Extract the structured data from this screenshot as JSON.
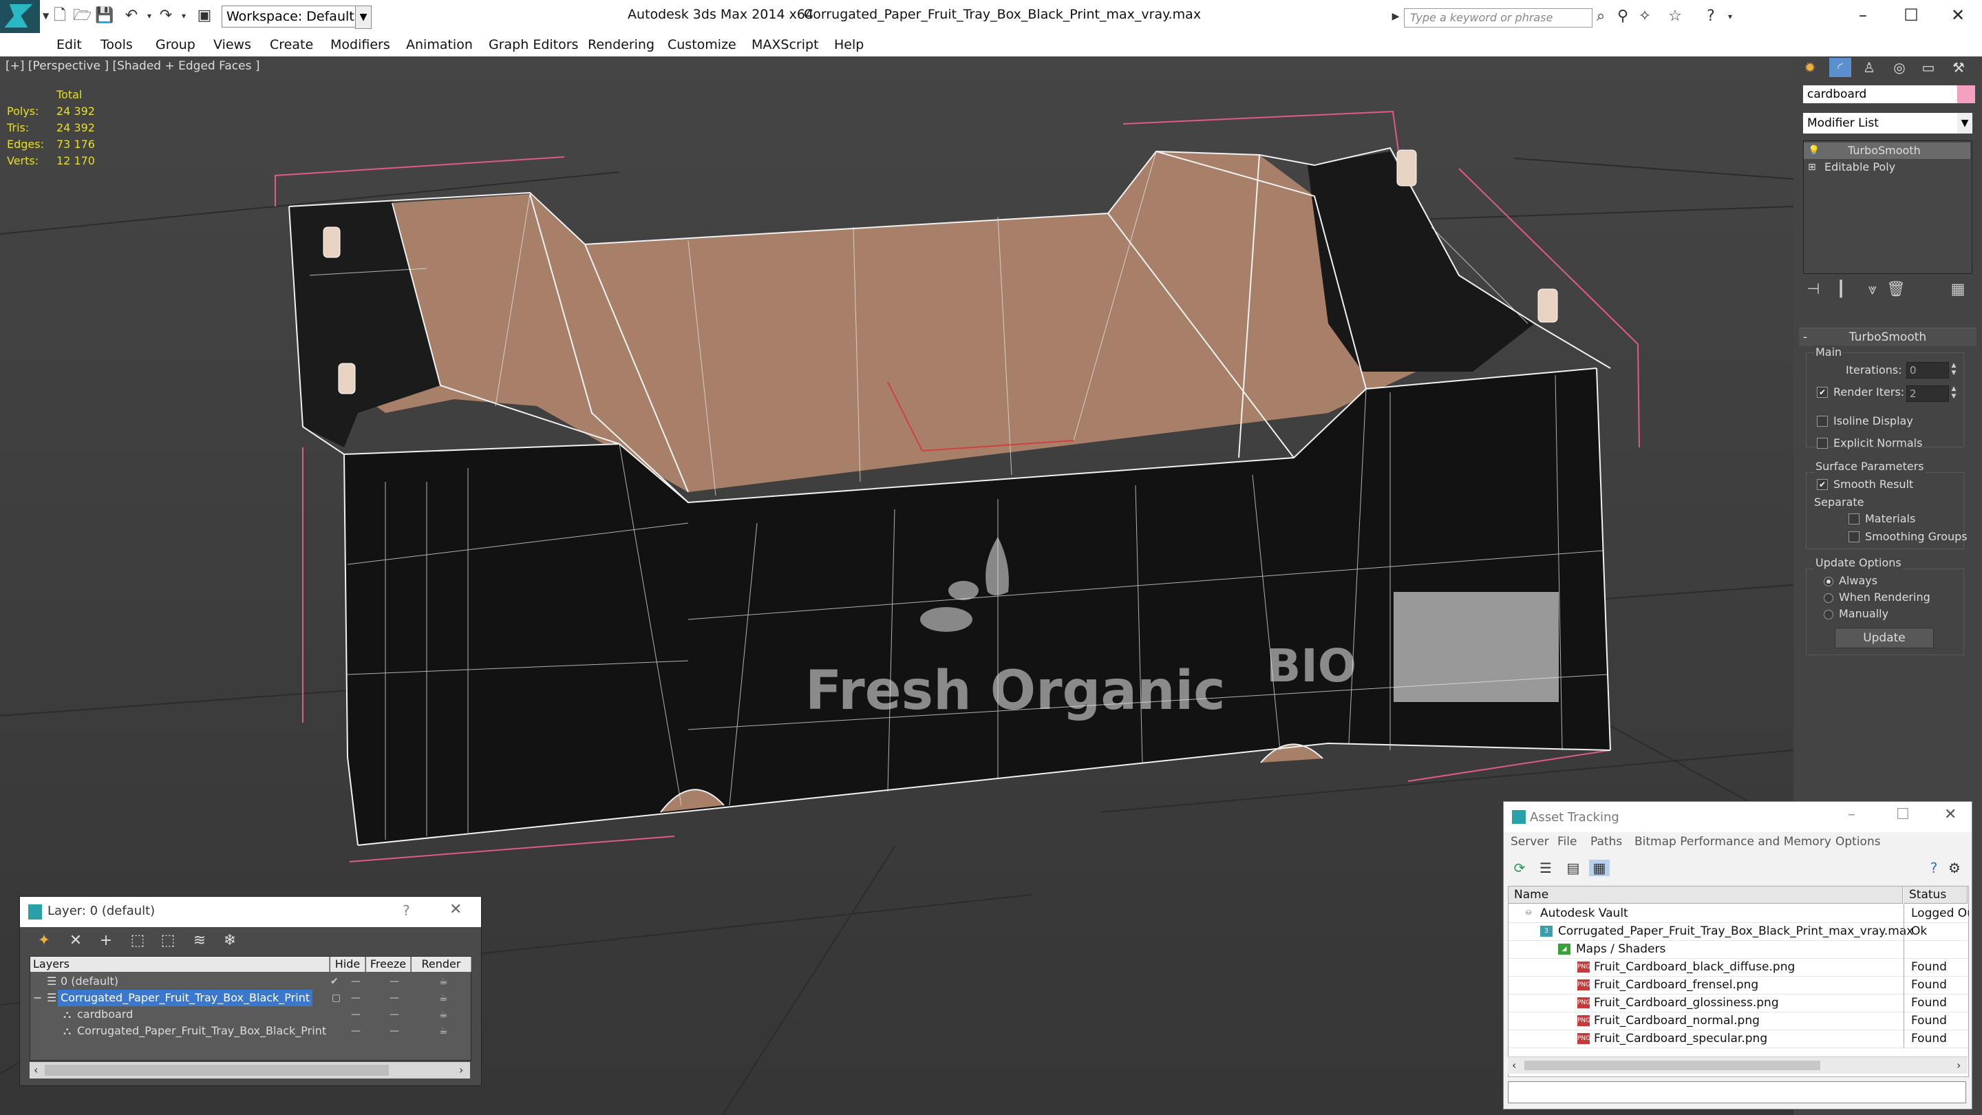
{
  "window": {
    "app_title": "Autodesk 3ds Max  2014 x64",
    "file_title": "Corrugated_Paper_Fruit_Tray_Box_Black_Print_max_vray.max",
    "workspace": "Workspace: Default",
    "search_placeholder": "Type a keyword or phrase",
    "minimize": "–",
    "maximize": "☐",
    "close": "✕"
  },
  "menu": [
    "Edit",
    "Tools",
    "Group",
    "Views",
    "Create",
    "Modifiers",
    "Animation",
    "Graph Editors",
    "Rendering",
    "Customize",
    "MAXScript",
    "Help"
  ],
  "viewport": {
    "label": "[+] [Perspective ] [Shaded + Edged Faces ]",
    "stats_header": "Total",
    "stats": [
      {
        "label": "Polys:",
        "value": "24 392"
      },
      {
        "label": "Tris:",
        "value": "24 392"
      },
      {
        "label": "Edges:",
        "value": "73 176"
      },
      {
        "label": "Verts:",
        "value": "12 170"
      }
    ],
    "print_main": "Fresh Organic",
    "print_side": "BIO"
  },
  "command_panel": {
    "object_name": "cardboard",
    "object_color": "#f4a0c0",
    "modifier_list": "Modifier List",
    "stack": [
      "TurboSmooth",
      "Editable Poly"
    ],
    "rollout_title": "TurboSmooth",
    "main_group": "Main",
    "iterations_label": "Iterations:",
    "iterations_value": "0",
    "render_iters_label": "Render Iters:",
    "render_iters_value": "2",
    "render_iters_checked": "✔",
    "isoline_label": "Isoline Display",
    "explicit_normals_label": "Explicit Normals",
    "surface_group": "Surface Parameters",
    "smooth_result_label": "Smooth Result",
    "smooth_result_checked": "✔",
    "separate_label": "Separate",
    "materials_label": "Materials",
    "smoothing_groups_label": "Smoothing Groups",
    "update_group": "Update Options",
    "always_label": "Always",
    "when_rendering_label": "When Rendering",
    "manually_label": "Manually",
    "update_button": "Update"
  },
  "layer_dialog": {
    "title": "Layer: 0 (default)",
    "help": "?",
    "close": "✕",
    "columns": [
      "Layers",
      "Hide",
      "Freeze",
      "Render"
    ],
    "rows": [
      {
        "name": "0 (default)",
        "indent": 1
      },
      {
        "name": "Corrugated_Paper_Fruit_Tray_Box_Black_Print",
        "indent": 1
      },
      {
        "name": "cardboard",
        "indent": 2
      },
      {
        "name": "Corrugated_Paper_Fruit_Tray_Box_Black_Print",
        "indent": 2
      }
    ]
  },
  "asset_tracking": {
    "title": "Asset Tracking",
    "menu": [
      "Server",
      "File",
      "Paths",
      "Bitmap Performance and Memory",
      "Options"
    ],
    "columns": [
      "Name",
      "Status"
    ],
    "rows": [
      {
        "name": "Autodesk Vault",
        "status": "Logged Out"
      },
      {
        "name": "Corrugated_Paper_Fruit_Tray_Box_Black_Print_max_vray.max",
        "status": "Ok"
      },
      {
        "name": "Maps / Shaders",
        "status": ""
      },
      {
        "name": "Fruit_Cardboard_black_diffuse.png",
        "status": "Found"
      },
      {
        "name": "Fruit_Cardboard_frensel.png",
        "status": "Found"
      },
      {
        "name": "Fruit_Cardboard_glossiness.png",
        "status": "Found"
      },
      {
        "name": "Fruit_Cardboard_normal.png",
        "status": "Found"
      },
      {
        "name": "Fruit_Cardboard_specular.png",
        "status": "Found"
      }
    ]
  }
}
